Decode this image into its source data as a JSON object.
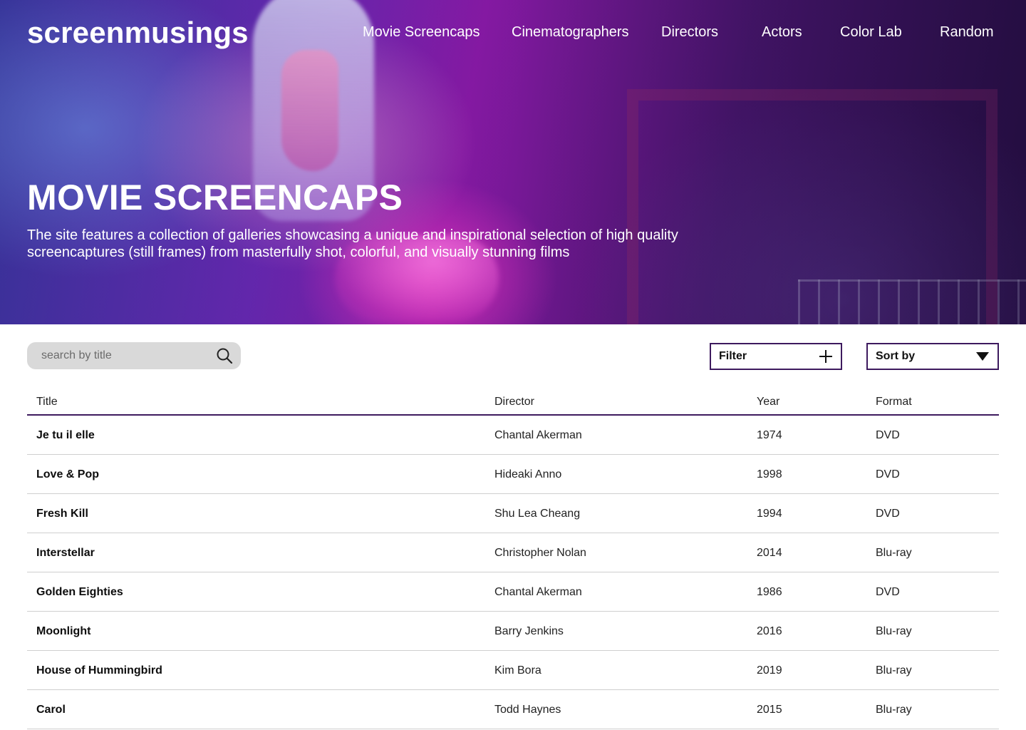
{
  "site": {
    "logo": "screenmusings"
  },
  "nav": [
    {
      "label": "Movie Screencaps"
    },
    {
      "label": "Cinematographers"
    },
    {
      "label": "Directors"
    },
    {
      "label": "Actors"
    },
    {
      "label": "Color Lab"
    },
    {
      "label": "Random"
    }
  ],
  "hero": {
    "title": "MOVIE SCREENCAPS",
    "description": "The site features a collection of galleries showcasing a unique and inspirational selection of high quality screencaptures (still frames) from masterfully shot, colorful, and visually stunning films"
  },
  "search": {
    "placeholder": "search by title",
    "icon": "search-icon"
  },
  "filter": {
    "label": "Filter",
    "icon": "plus-icon"
  },
  "sort": {
    "label": "Sort by",
    "icon": "caret-down-icon"
  },
  "colors": {
    "accent": "#3d1a5e",
    "search_bg": "#d9d9d9",
    "row_divider": "#cfcfcf"
  },
  "table": {
    "headers": [
      "Title",
      "Director",
      "Year",
      "Format"
    ],
    "rows": [
      {
        "title": "Je tu il elle",
        "director": "Chantal Akerman",
        "year": "1974",
        "format": "DVD"
      },
      {
        "title": "Love & Pop",
        "director": "Hideaki Anno",
        "year": "1998",
        "format": "DVD"
      },
      {
        "title": "Fresh Kill",
        "director": "Shu Lea Cheang",
        "year": "1994",
        "format": "DVD"
      },
      {
        "title": "Interstellar",
        "director": "Christopher Nolan",
        "year": "2014",
        "format": "Blu-ray"
      },
      {
        "title": "Golden Eighties",
        "director": "Chantal Akerman",
        "year": "1986",
        "format": "DVD"
      },
      {
        "title": "Moonlight",
        "director": "Barry Jenkins",
        "year": "2016",
        "format": "Blu-ray"
      },
      {
        "title": "House of Hummingbird",
        "director": "Kim Bora",
        "year": "2019",
        "format": "Blu-ray"
      },
      {
        "title": "Carol",
        "director": "Todd Haynes",
        "year": "2015",
        "format": "Blu-ray"
      }
    ]
  }
}
